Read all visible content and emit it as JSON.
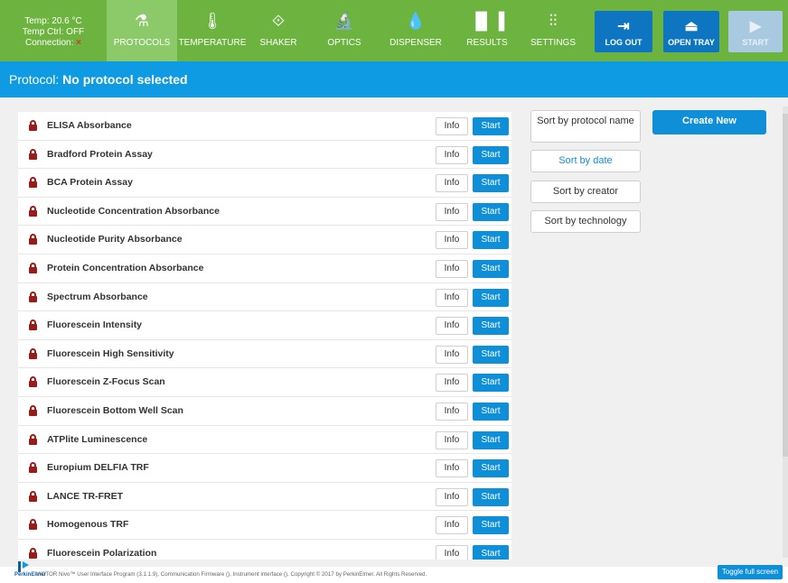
{
  "status": {
    "temp": "Temp: 20.6 °C",
    "temp_ctrl": "Temp Ctrl: OFF",
    "connection_label": "Connection:",
    "connection_mark": "×"
  },
  "nav": {
    "protocols": {
      "label": "PROTOCOLS",
      "icon": "flask-icon"
    },
    "temperature": {
      "label": "TEMPERATURE",
      "icon": "thermometer-icon"
    },
    "shaker": {
      "label": "SHAKER",
      "icon": "shaker-icon"
    },
    "optics": {
      "label": "OPTICS",
      "icon": "microscope-icon"
    },
    "dispenser": {
      "label": "DISPENSER",
      "icon": "droplets-icon"
    },
    "results": {
      "label": "RESULTS",
      "icon": "bar-chart-icon"
    },
    "settings": {
      "label": "SETTINGS",
      "icon": "sliders-icon"
    }
  },
  "buttons": {
    "logout": "LOG OUT",
    "open_tray": "OPEN TRAY",
    "start": "START"
  },
  "banner": {
    "prefix": "Protocol:",
    "value": "No protocol selected"
  },
  "protocols": [
    "ELISA Absorbance",
    "Bradford Protein Assay",
    "BCA Protein Assay",
    "Nucleotide Concentration Absorbance",
    "Nucleotide Purity Absorbance",
    "Protein Concentration Absorbance",
    "Spectrum Absorbance",
    "Fluorescein Intensity",
    "Fluorescein High Sensitivity",
    "Fluorescein Z-Focus Scan",
    "Fluorescein Bottom Well Scan",
    "ATPlite Luminescence",
    "Europium DELFIA TRF",
    "LANCE TR-FRET",
    "Homogenous TRF",
    "Fluorescein Polarization"
  ],
  "row_buttons": {
    "info": "Info",
    "start": "Start"
  },
  "sort": {
    "by_name": "Sort by protocol name",
    "by_date": "Sort by date",
    "by_creator": "Sort by creator",
    "by_technology": "Sort by technology"
  },
  "create_new": "Create New",
  "footer": {
    "brand": "PerkinElmer",
    "copyright": "VICTOR Nivo™ User Interface Program (3.1.1.9), Communication Firmware (), Instrument interface (), Copyright © 2017 by PerkinElmer. All Rights Reserved.",
    "toggle_full_screen": "Toggle full screen"
  },
  "colors": {
    "topbar": "#6cb33f",
    "active_tab": "#8cc969",
    "banner": "#0f9be3",
    "accent": "#0f8fd8",
    "lock": "#9b1b1b"
  }
}
